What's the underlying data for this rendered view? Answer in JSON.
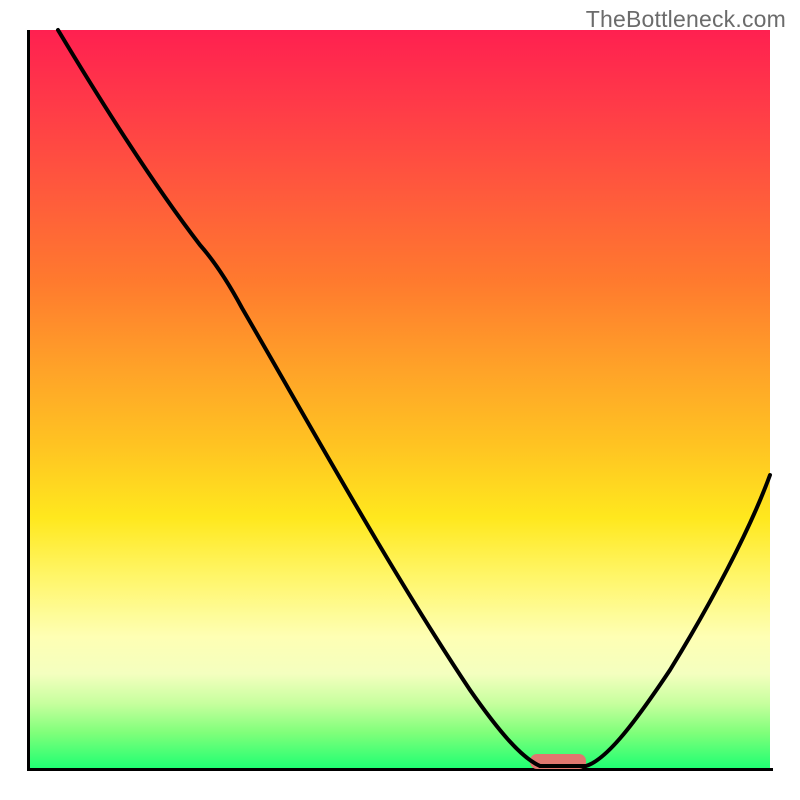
{
  "watermark": "TheBottleneck.com",
  "chart_data": {
    "type": "line",
    "title": "",
    "xlabel": "",
    "ylabel": "",
    "xlim": [
      0,
      100
    ],
    "ylim": [
      0,
      100
    ],
    "grid": false,
    "legend": false,
    "background_gradient": [
      {
        "stop": 0,
        "color": "#ff2050"
      },
      {
        "stop": 50,
        "color": "#ffb024"
      },
      {
        "stop": 72,
        "color": "#ffee30"
      },
      {
        "stop": 85,
        "color": "#f8ffc0"
      },
      {
        "stop": 100,
        "color": "#1aff72"
      }
    ],
    "series": [
      {
        "name": "bottleneck-curve",
        "x": [
          5,
          12,
          20,
          26,
          35,
          45,
          55,
          62,
          66,
          70,
          74,
          80,
          88,
          95,
          100
        ],
        "y": [
          100,
          90,
          78,
          70,
          55,
          40,
          23,
          12,
          4,
          0,
          0,
          6,
          20,
          33,
          42
        ]
      }
    ],
    "marker": {
      "name": "optimal-range",
      "shape": "capsule",
      "x_center": 72,
      "y": 0,
      "width_x": 6,
      "color": "#e0776f"
    }
  }
}
